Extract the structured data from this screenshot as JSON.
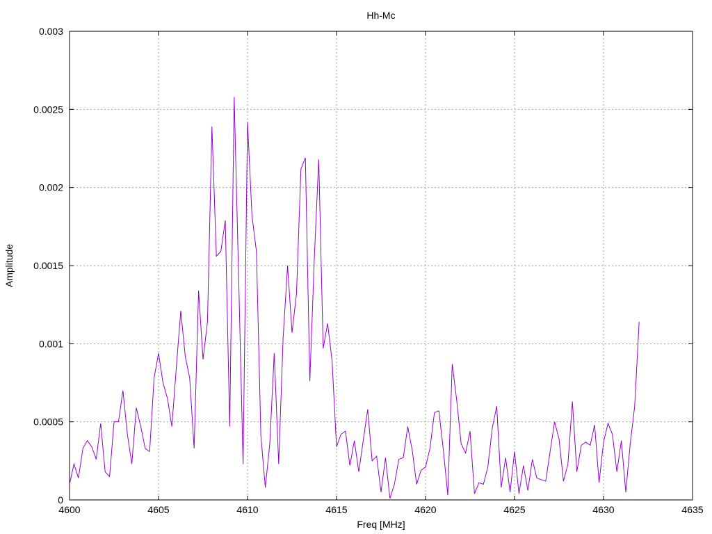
{
  "chart_data": {
    "type": "line",
    "title": "Hh-Mc",
    "xlabel": "Freq [MHz]",
    "ylabel": "Amplitude",
    "xlim": [
      4600,
      4635
    ],
    "ylim": [
      0,
      0.003
    ],
    "xticks": [
      "4600",
      "4605",
      "4610",
      "4615",
      "4620",
      "4625",
      "4630",
      "4635"
    ],
    "yticks": [
      "0",
      "0.0005",
      "0.001",
      "0.0015",
      "0.002",
      "0.0025",
      "0.003"
    ],
    "grid": true,
    "series": [
      {
        "color": "#9400d3",
        "x": [
          4600,
          4600.25,
          4600.5,
          4600.75,
          4601,
          4601.25,
          4601.5,
          4601.75,
          4602,
          4602.25,
          4602.5,
          4602.75,
          4603,
          4603.25,
          4603.5,
          4603.75,
          4604,
          4604.25,
          4604.5,
          4604.75,
          4605,
          4605.25,
          4605.5,
          4605.75,
          4606,
          4606.25,
          4606.5,
          4606.75,
          4607,
          4607.25,
          4607.5,
          4607.75,
          4608,
          4608.25,
          4608.5,
          4608.75,
          4609,
          4609.25,
          4609.5,
          4609.75,
          4610,
          4610.25,
          4610.5,
          4610.75,
          4611,
          4611.25,
          4611.5,
          4611.75,
          4612,
          4612.25,
          4612.5,
          4612.75,
          4613,
          4613.25,
          4613.5,
          4613.75,
          4614,
          4614.25,
          4614.5,
          4614.75,
          4615,
          4615.25,
          4615.5,
          4615.75,
          4616,
          4616.25,
          4616.5,
          4616.75,
          4617,
          4617.25,
          4617.5,
          4617.75,
          4618,
          4618.25,
          4618.5,
          4618.75,
          4619,
          4619.25,
          4619.5,
          4619.75,
          4620,
          4620.25,
          4620.5,
          4620.75,
          4621,
          4621.25,
          4621.5,
          4621.75,
          4622,
          4622.25,
          4622.5,
          4622.75,
          4623,
          4623.25,
          4623.5,
          4623.75,
          4624,
          4624.25,
          4624.5,
          4624.75,
          4625,
          4625.25,
          4625.5,
          4625.75,
          4626,
          4626.25,
          4626.5,
          4626.75,
          4627,
          4627.25,
          4627.5,
          4627.75,
          4628,
          4628.25,
          4628.5,
          4628.75,
          4629,
          4629.25,
          4629.5,
          4629.75,
          4630,
          4630.25,
          4630.5,
          4630.75,
          4631,
          4631.25,
          4631.5,
          4631.75,
          4632
        ],
        "y": [
          0.0001,
          0.00023,
          0.00014,
          0.00033,
          0.00038,
          0.00034,
          0.00026,
          0.00049,
          0.00018,
          0.00015,
          0.0005,
          0.0005,
          0.0007,
          0.00042,
          0.00023,
          0.00059,
          0.00047,
          0.00033,
          0.00031,
          0.00078,
          0.00094,
          0.00075,
          0.00065,
          0.00047,
          0.00085,
          0.00121,
          0.00092,
          0.00078,
          0.00033,
          0.00134,
          0.0009,
          0.00114,
          0.00239,
          0.00156,
          0.00159,
          0.00179,
          0.00047,
          0.00258,
          0.00143,
          0.00023,
          0.00242,
          0.00182,
          0.00159,
          0.00041,
          8e-05,
          0.00036,
          0.00094,
          0.00023,
          0.00104,
          0.0015,
          0.00107,
          0.00132,
          0.00212,
          0.00219,
          0.00076,
          0.00154,
          0.00218,
          0.00097,
          0.00113,
          0.00089,
          0.00034,
          0.00042,
          0.00044,
          0.00022,
          0.00038,
          0.00018,
          0.00038,
          0.00058,
          0.00025,
          0.00028,
          5e-05,
          0.00027,
          1e-05,
          0.0001,
          0.00026,
          0.00027,
          0.00047,
          0.00032,
          0.0001,
          0.00019,
          0.00021,
          0.00033,
          0.00056,
          0.00057,
          0.00032,
          3e-05,
          0.00087,
          0.00064,
          0.00036,
          0.0003,
          0.00044,
          4e-05,
          0.00011,
          0.0001,
          0.00021,
          0.00046,
          0.0006,
          8e-05,
          0.00027,
          5e-05,
          0.00031,
          4e-05,
          0.00022,
          6e-05,
          0.00026,
          0.00014,
          0.00013,
          0.00012,
          0.00031,
          0.0005,
          0.00039,
          0.00012,
          0.00023,
          0.00063,
          0.00018,
          0.00035,
          0.00037,
          0.00035,
          0.00048,
          0.00011,
          0.00037,
          0.00049,
          0.00042,
          0.00018,
          0.00038,
          5e-05,
          0.00036,
          0.0006,
          0.00114
        ]
      }
    ]
  }
}
